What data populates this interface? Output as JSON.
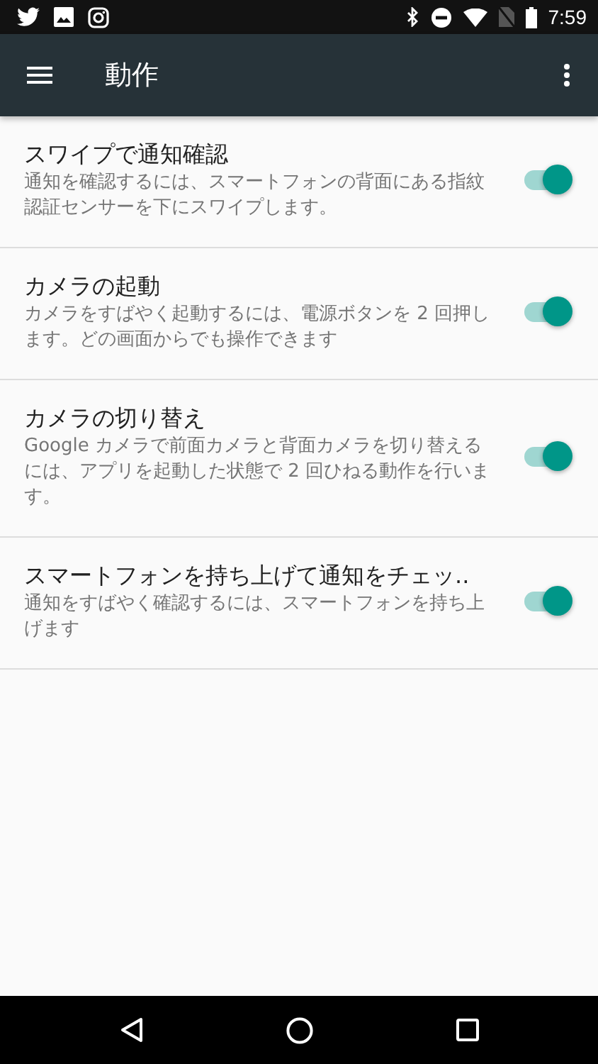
{
  "status_bar": {
    "time": "7:59"
  },
  "app_bar": {
    "title": "動作"
  },
  "settings": [
    {
      "title": "スワイプで通知確認",
      "summary": "通知を確認するには、スマートフォンの背面にある指紋認証センサーを下にスワイプします。",
      "on": true
    },
    {
      "title": "カメラの起動",
      "summary": "カメラをすばやく起動するには、電源ボタンを 2 回押します。どの画面からでも操作できます",
      "on": true
    },
    {
      "title": "カメラの切り替え",
      "summary": "Google カメラで前面カメラと背面カメラを切り替えるには、アプリを起動した状態で 2 回ひねる動作を行います。",
      "on": true
    },
    {
      "title": "スマートフォンを持ち上げて通知をチェッ..",
      "summary": "通知をすばやく確認するには、スマートフォンを持ち上げます",
      "on": true
    }
  ]
}
